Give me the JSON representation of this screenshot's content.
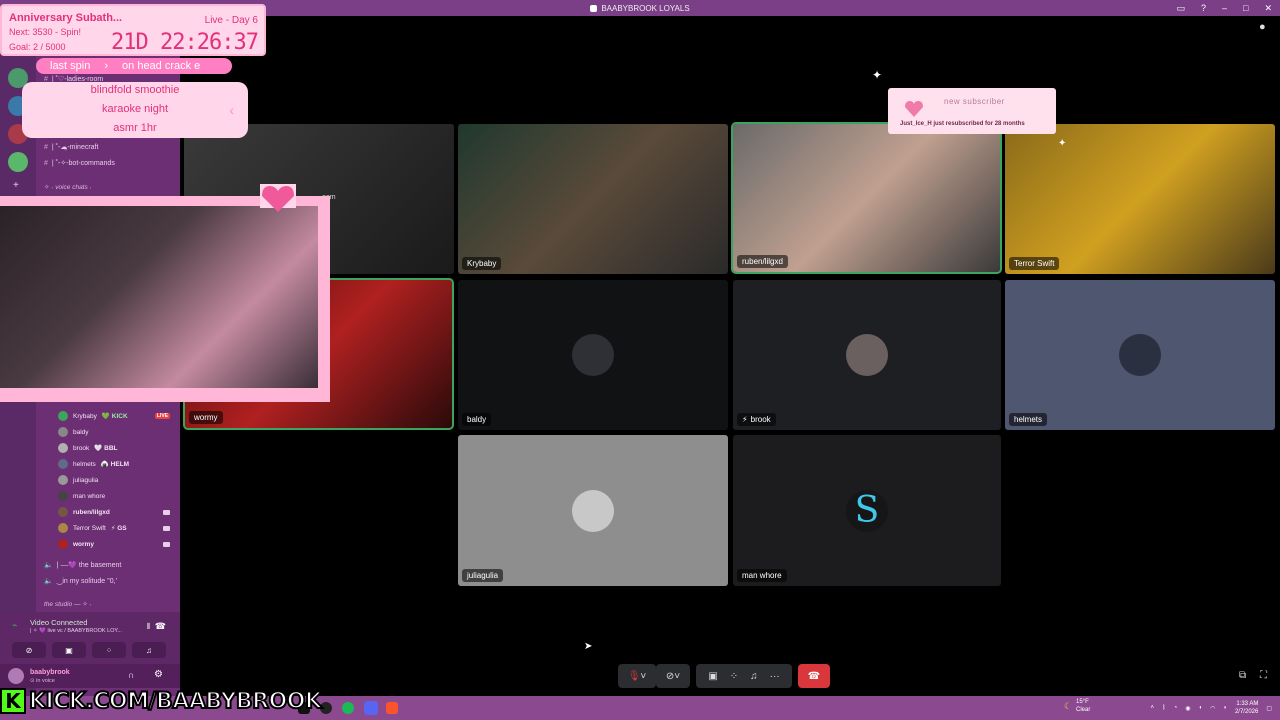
{
  "window": {
    "title": "BAABYBROOK LOYALS"
  },
  "counter": {
    "title": "Anniversary Subath...",
    "next": "Next: 3530 - Spin!",
    "goal": "Goal: 2 / 5000",
    "day": "Live - Day 6",
    "timer": "21D 22:26:37"
  },
  "spin": {
    "last_label": "last spin",
    "last_value": "on head crack e",
    "items": [
      "blindfold smoothie",
      "karaoke night",
      "asmr 1hr"
    ]
  },
  "channels": [
    {
      "name": "| ˚♡-ladies-room"
    },
    {
      "name": "| ˚-☁̤-minecraft"
    },
    {
      "name": "| ˚-✧-bot-commands"
    }
  ],
  "sections": {
    "voice_chats": "✧ ˖ voice chats ˖",
    "studio": "the studio — ✧ ˖"
  },
  "voice_users": [
    {
      "name": "Krybaby",
      "tag": "💚 KICK",
      "live": "LIVE",
      "color": "#3ba55c"
    },
    {
      "name": "baldy",
      "tag": "",
      "color": "#888888"
    },
    {
      "name": "brook",
      "tag": "🤍 BBL",
      "color": "#b0b0b0"
    },
    {
      "name": "helmets",
      "tag": "🍙 HELM",
      "color": "#5f6b8a"
    },
    {
      "name": "juliagulia",
      "tag": "",
      "color": "#999999"
    },
    {
      "name": "man whore",
      "tag": "",
      "color": "#444444"
    },
    {
      "name": "ruben/lilgxd",
      "tag": "",
      "color": "#775544"
    },
    {
      "name": "Terror Swift",
      "tag": "⚡ GS",
      "color": "#aa8844"
    },
    {
      "name": "wormy",
      "tag": "",
      "color": "#aa2222"
    }
  ],
  "voice_channels": [
    {
      "name": "| ––💜 the basement"
    },
    {
      "name": "‿in my solitude ''0,'"
    }
  ],
  "voice_panel": {
    "status": "Video Connected",
    "channel": "| ✧ 💜 live vc / BAABYBROOK LOY..."
  },
  "user_panel": {
    "name": "baabybrook",
    "status": "⊙ in voice"
  },
  "tiles": [
    {
      "name": "Krybaby",
      "speaking": false
    },
    {
      "name": "ruben/lilgxd",
      "speaking": true
    },
    {
      "name": "Terror Swift",
      "speaking": false
    },
    {
      "name": "wormy",
      "speaking": true
    },
    {
      "name": "baldy",
      "speaking": false
    },
    {
      "name": "brook",
      "speaking": false
    },
    {
      "name": "helmets",
      "speaking": false
    },
    {
      "name": "juliagulia",
      "speaking": false
    },
    {
      "name": "man whore",
      "speaking": false
    }
  ],
  "stream_partial_label": "eam",
  "sub_alert": {
    "title": "new subscriber",
    "message": "Just_Ice_H just resubscribed for 28 months"
  },
  "kick": {
    "text": "KICK.COM/BAABYBROOK",
    "logo": "K"
  },
  "tray": {
    "weather_temp": "15°F",
    "weather_desc": "Clear",
    "time": "1:33 AM",
    "date": "2/7/2026"
  },
  "colors": {
    "accent": "#7a3f86",
    "sidebar": "#6d2f74",
    "pink": "#ffd6ea",
    "hangup": "#da373c",
    "speaking": "#3ba55c"
  }
}
